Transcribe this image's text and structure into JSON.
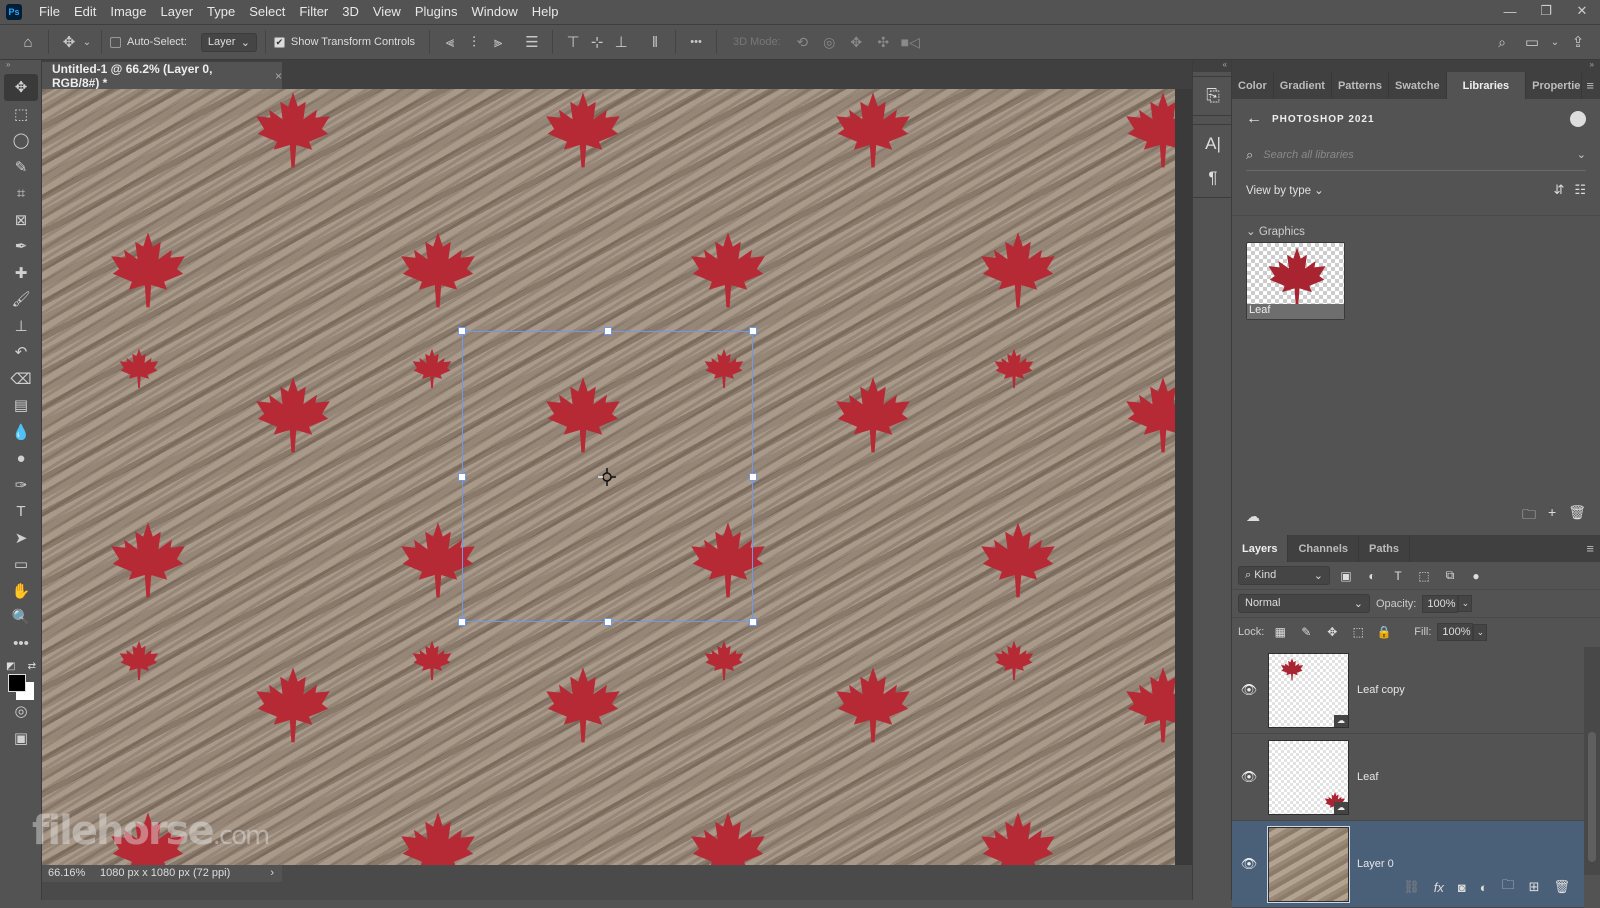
{
  "app": {
    "logo": "Ps",
    "name": "Adobe Photoshop"
  },
  "menu": [
    "File",
    "Edit",
    "Image",
    "Layer",
    "Type",
    "Select",
    "Filter",
    "3D",
    "View",
    "Plugins",
    "Window",
    "Help"
  ],
  "window_controls": {
    "minimize": "—",
    "restore": "❐",
    "close": "✕"
  },
  "options_bar": {
    "home_icon": "⌂",
    "move_icon": "✥",
    "chevron": "⌄",
    "auto_select_label": "Auto-Select:",
    "auto_select_checked": false,
    "auto_select_target": "Layer",
    "show_transform_label": "Show Transform Controls",
    "show_transform_checked": true,
    "more_icon": "•••",
    "mode_3d_label": "3D Mode:",
    "search_icon": "🔍",
    "workspace_icon": "▭",
    "share_icon": "⇪"
  },
  "document": {
    "tab_title": "Untitled-1 @ 66.2% (Layer 0, RGB/8#) *",
    "close": "×",
    "zoom": "66.16%",
    "info": "1080 px x 1080 px (72 ppi)",
    "info_arrow": "›"
  },
  "toolbox": {
    "collapse": "»",
    "tools": [
      {
        "name": "move-tool",
        "glyph": "✥",
        "active": true
      },
      {
        "name": "marquee-tool",
        "glyph": "⬚"
      },
      {
        "name": "lasso-tool",
        "glyph": "◯"
      },
      {
        "name": "quick-select-tool",
        "glyph": "✎"
      },
      {
        "name": "crop-tool",
        "glyph": "⌗"
      },
      {
        "name": "frame-tool",
        "glyph": "⊠"
      },
      {
        "name": "eyedropper-tool",
        "glyph": "✒"
      },
      {
        "name": "healing-brush-tool",
        "glyph": "✚"
      },
      {
        "name": "brush-tool",
        "glyph": "🖌"
      },
      {
        "name": "stamp-tool",
        "glyph": "⊥"
      },
      {
        "name": "history-brush-tool",
        "glyph": "↶"
      },
      {
        "name": "eraser-tool",
        "glyph": "⌫"
      },
      {
        "name": "gradient-tool",
        "glyph": "▤"
      },
      {
        "name": "blur-tool",
        "glyph": "💧"
      },
      {
        "name": "dodge-tool",
        "glyph": "●"
      },
      {
        "name": "pen-tool",
        "glyph": "✑"
      },
      {
        "name": "type-tool",
        "glyph": "T"
      },
      {
        "name": "path-select-tool",
        "glyph": "➤"
      },
      {
        "name": "rectangle-tool",
        "glyph": "▭"
      },
      {
        "name": "hand-tool",
        "glyph": "✋"
      },
      {
        "name": "zoom-tool",
        "glyph": "🔍"
      },
      {
        "name": "edit-toolbar",
        "glyph": "•••"
      }
    ],
    "swap_icon": "⇄",
    "default_colors_icon": "◩",
    "quick_mask_icon": "◎",
    "screen_mode_icon": "▣"
  },
  "right_dock": {
    "collapse": "«",
    "buttons": [
      "⎘",
      "A|",
      "¶"
    ]
  },
  "libraries_panel": {
    "tabs": [
      "Color",
      "Gradient",
      "Patterns",
      "Swatche",
      "Libraries",
      "Propertie"
    ],
    "active_tab": "Libraries",
    "menu_icon": "≡",
    "back_icon": "←",
    "library_name": "PHOTOSHOP 2021",
    "search_placeholder": "Search all libraries",
    "view_by": "View by type ⌄",
    "section": "Graphics",
    "section_chevron": "⌄",
    "items": [
      {
        "label": "Leaf"
      }
    ],
    "footer": {
      "cloud_icon": "☁",
      "folder_icon": "🗀",
      "add_icon": "+",
      "delete_icon": "🗑"
    }
  },
  "layers_panel": {
    "tabs": [
      "Layers",
      "Channels",
      "Paths"
    ],
    "active_tab": "Layers",
    "filter_kind": "Kind",
    "blend_mode": "Normal",
    "opacity_label": "Opacity:",
    "opacity": "100%",
    "lock_label": "Lock:",
    "fill_label": "Fill:",
    "fill": "100%",
    "layers": [
      {
        "name": "Leaf copy",
        "visible": true,
        "selected": false
      },
      {
        "name": "Leaf",
        "visible": true,
        "selected": false
      },
      {
        "name": "Layer 0",
        "visible": true,
        "selected": true
      }
    ],
    "footer_icons": [
      "link",
      "fx",
      "mask",
      "adjustment",
      "group",
      "new-layer",
      "delete"
    ]
  },
  "watermark": {
    "brand": "filehorse",
    "suffix": ".com"
  },
  "colors": {
    "leaf": "#b52a35",
    "selection": "#6f98e8",
    "selected_layer": "#4a5f78"
  }
}
